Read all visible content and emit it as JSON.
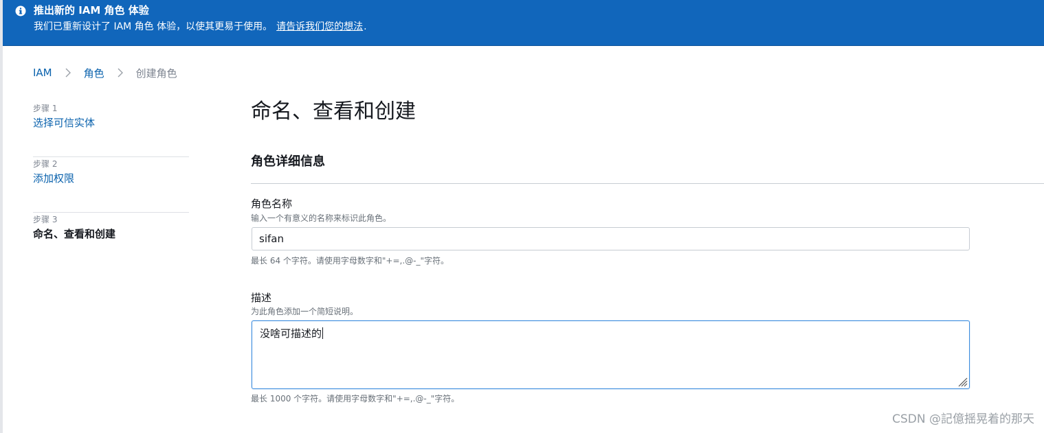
{
  "banner": {
    "title": "推出新的 IAM 角色 体验",
    "text": "我们已重新设计了 IAM 角色 体验，以使其更易于使用。",
    "link": "请告诉我们您的想法",
    "text_end": "."
  },
  "breadcrumb": {
    "items": [
      "IAM",
      "角色"
    ],
    "current": "创建角色"
  },
  "steps": [
    {
      "number": "步骤 1",
      "title": "选择可信实体"
    },
    {
      "number": "步骤 2",
      "title": "添加权限"
    },
    {
      "number": "步骤 3",
      "title": "命名、查看和创建"
    }
  ],
  "main": {
    "title": "命名、查看和创建",
    "section_title": "角色详细信息",
    "role_name": {
      "label": "角色名称",
      "hint": "输入一个有意义的名称来标识此角色。",
      "value": "sifan",
      "constraint": "最长 64 个字符。请使用字母数字和\"+=,.@-_\"字符。"
    },
    "description": {
      "label": "描述",
      "hint": "为此角色添加一个简短说明。",
      "value": "没啥可描述的",
      "constraint": "最长 1000 个字符。请使用字母数字和\"+=,.@-_\"字符。"
    }
  },
  "watermark": "CSDN @記億揺晃着的那天",
  "colors": {
    "banner_bg": "#1166bb",
    "link": "#0a62ad",
    "focus_border": "#3c8cde"
  }
}
